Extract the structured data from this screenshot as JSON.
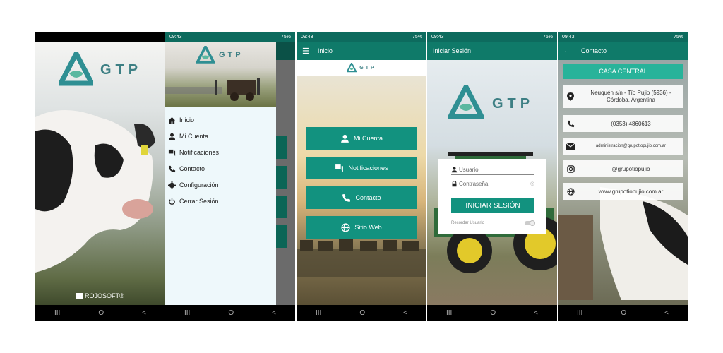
{
  "status": {
    "time": "09:43",
    "battery": "75%"
  },
  "brand": {
    "logo_text": "GTP",
    "footer": "ROJOSOFT®"
  },
  "nav": {
    "recent": "III",
    "home": "O",
    "back": "<"
  },
  "drawer": {
    "items": [
      {
        "label": "Inicio",
        "icon": "home-icon"
      },
      {
        "label": "Mi Cuenta",
        "icon": "person-icon"
      },
      {
        "label": "Notificaciones",
        "icon": "chat-icon"
      },
      {
        "label": "Contacto",
        "icon": "phone-icon"
      },
      {
        "label": "Configuración",
        "icon": "gear-icon"
      },
      {
        "label": "Cerrar Sesión",
        "icon": "power-icon"
      }
    ]
  },
  "home": {
    "title": "Inicio",
    "buttons": [
      {
        "label": "Mi Cuenta",
        "icon": "person-icon"
      },
      {
        "label": "Notificaciones",
        "icon": "chat-icon"
      },
      {
        "label": "Contacto",
        "icon": "phone-icon"
      },
      {
        "label": "Sitio Web",
        "icon": "globe-icon"
      }
    ]
  },
  "login": {
    "title": "Iniciar Sesión",
    "user_placeholder": "Usuario",
    "password_placeholder": "Contraseña",
    "submit": "INICIAR SESIÓN",
    "remember": "Recordar Usuario"
  },
  "contact": {
    "title": "Contacto",
    "header": "CASA CENTRAL",
    "address": "Neuquén s/n - Tío Pujio (5936) - Córdoba, Argentina",
    "phone": "(0353) 4860613",
    "email": "administracion@grupotiopujio.com.ar",
    "instagram": "@grupotiopujio",
    "web": "www.grupotiopujio.com.ar"
  },
  "colors": {
    "primary": "#0f7a69",
    "button": "#12927f",
    "accent": "#28b39a"
  }
}
